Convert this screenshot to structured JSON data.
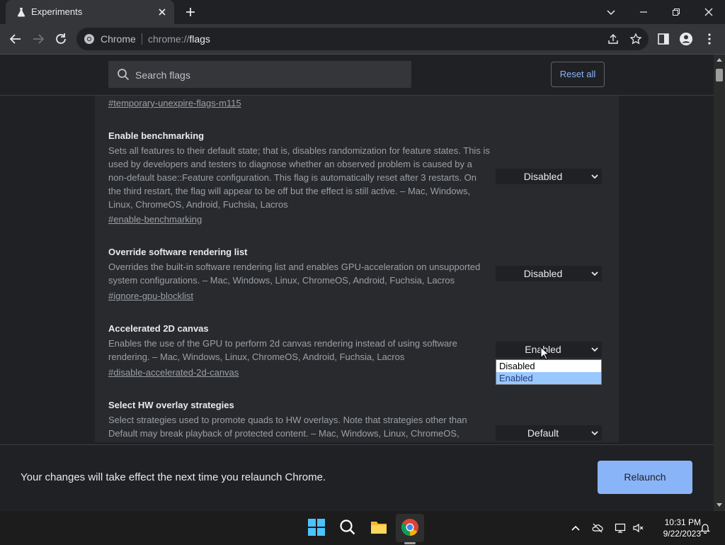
{
  "tab": {
    "title": "Experiments"
  },
  "omnibox": {
    "site_label": "Chrome",
    "url_prefix": "chrome://",
    "url_path": "flags"
  },
  "search": {
    "placeholder": "Search flags"
  },
  "reset_label": "Reset all",
  "flags": [
    {
      "link": "#temporary-unexpire-flags-m115"
    },
    {
      "title": "Enable benchmarking",
      "description": "Sets all features to their default state; that is, disables randomization for feature states. This is used by developers and testers to diagnose whether an observed problem is caused by a non-default base::Feature configuration. This flag is automatically reset after 3 restarts. On the third restart, the flag will appear to be off but the effect is still active. – Mac, Windows, Linux, ChromeOS, Android, Fuchsia, Lacros",
      "link": "#enable-benchmarking",
      "value": "Disabled"
    },
    {
      "title": "Override software rendering list",
      "description": "Overrides the built-in software rendering list and enables GPU-acceleration on unsupported system configurations. – Mac, Windows, Linux, ChromeOS, Android, Fuchsia, Lacros",
      "link": "#ignore-gpu-blocklist",
      "value": "Disabled"
    },
    {
      "title": "Accelerated 2D canvas",
      "description": "Enables the use of the GPU to perform 2d canvas rendering instead of using software rendering. – Mac, Windows, Linux, ChromeOS, Android, Fuchsia, Lacros",
      "link": "#disable-accelerated-2d-canvas",
      "value": "Enabled"
    },
    {
      "title": "Select HW overlay strategies",
      "description": "Select strategies used to promote quads to HW overlays. Note that strategies other than Default may break playback of protected content. – Mac, Windows, Linux, ChromeOS,",
      "value": "Default"
    }
  ],
  "dropdown": {
    "options": [
      "Disabled",
      "Enabled"
    ],
    "selected": "Enabled"
  },
  "relaunch": {
    "message": "Your changes will take effect the next time you relaunch Chrome.",
    "button": "Relaunch"
  },
  "clock": {
    "time": "10:31 PM",
    "date": "9/22/2023"
  },
  "colors": {
    "accent": "#8ab4f8",
    "background": "#202124",
    "card": "#292a2d",
    "toolbar": "#35363a"
  }
}
